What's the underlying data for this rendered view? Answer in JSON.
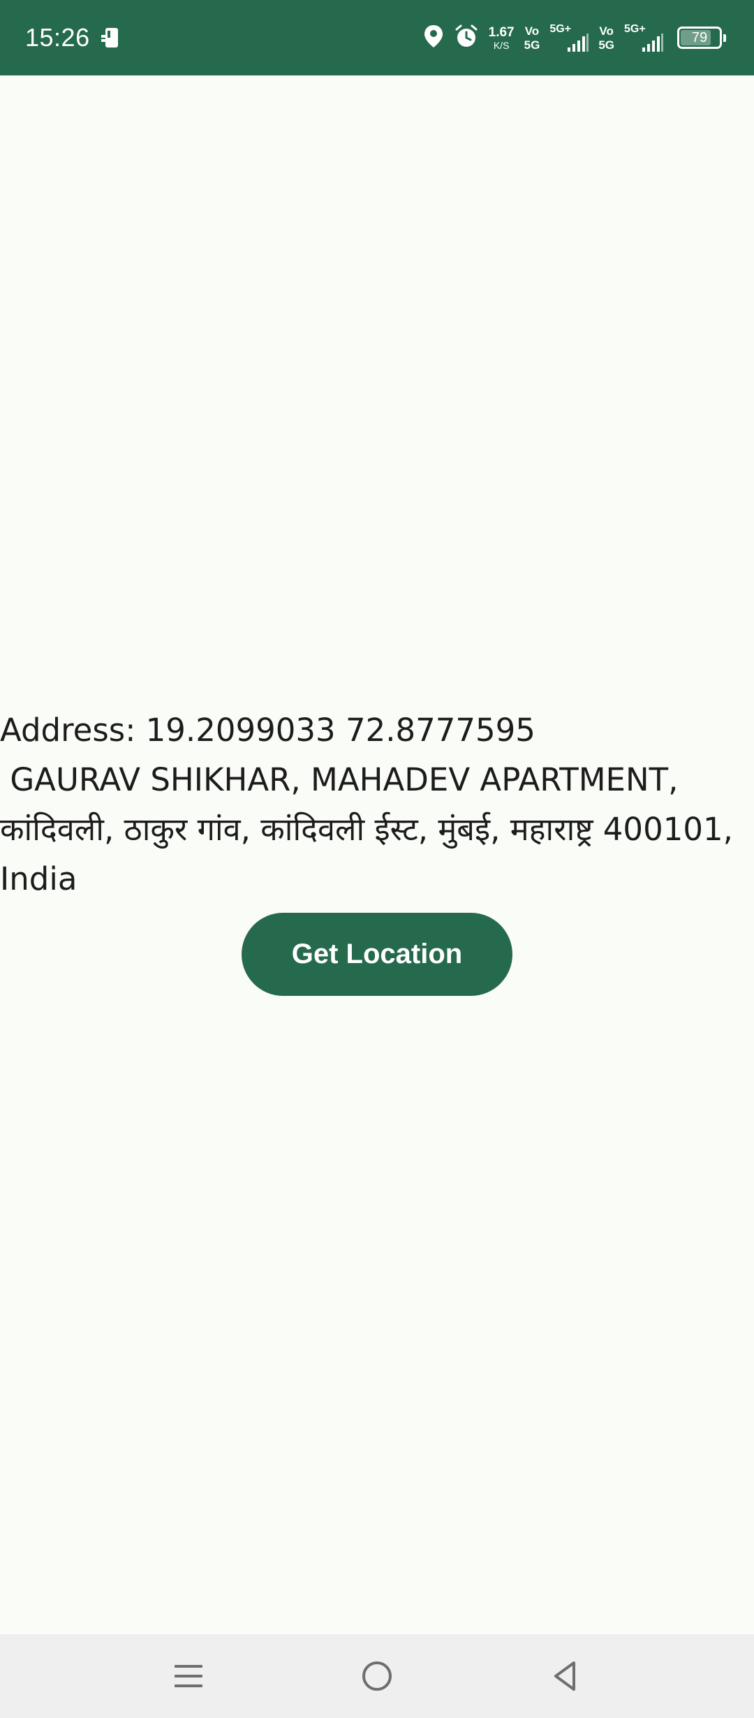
{
  "status_bar": {
    "time": "15:26",
    "network_speed_value": "1.67",
    "network_speed_unit": "K/S",
    "sim1": {
      "volte_top": "Vo",
      "volte_bottom": "5G",
      "network_type": "5G+"
    },
    "sim2": {
      "volte_top": "Vo",
      "volte_bottom": "5G",
      "network_type": "5G+"
    },
    "battery_level": "79",
    "battery_fraction": 0.79,
    "icons": [
      "notification-app-icon",
      "location-icon",
      "alarm-icon",
      "signal-icon",
      "signal-icon",
      "battery-icon"
    ]
  },
  "main": {
    "address_text": "Address: 19.2099033 72.8777595\n GAURAV SHIKHAR, MAHADEV APARTMENT, कांदिवली, ठाकुर गांव, कांदिवली ईस्ट, मुंबई, महाराष्ट्र 400101, India",
    "get_location_label": "Get Location"
  },
  "nav_bar": {
    "icons": [
      "recents-icon",
      "home-icon",
      "back-icon"
    ]
  },
  "colors": {
    "accent": "#256a4d",
    "background": "#fafcf7",
    "text": "#1c1c1c",
    "nav_background": "#efefef"
  }
}
